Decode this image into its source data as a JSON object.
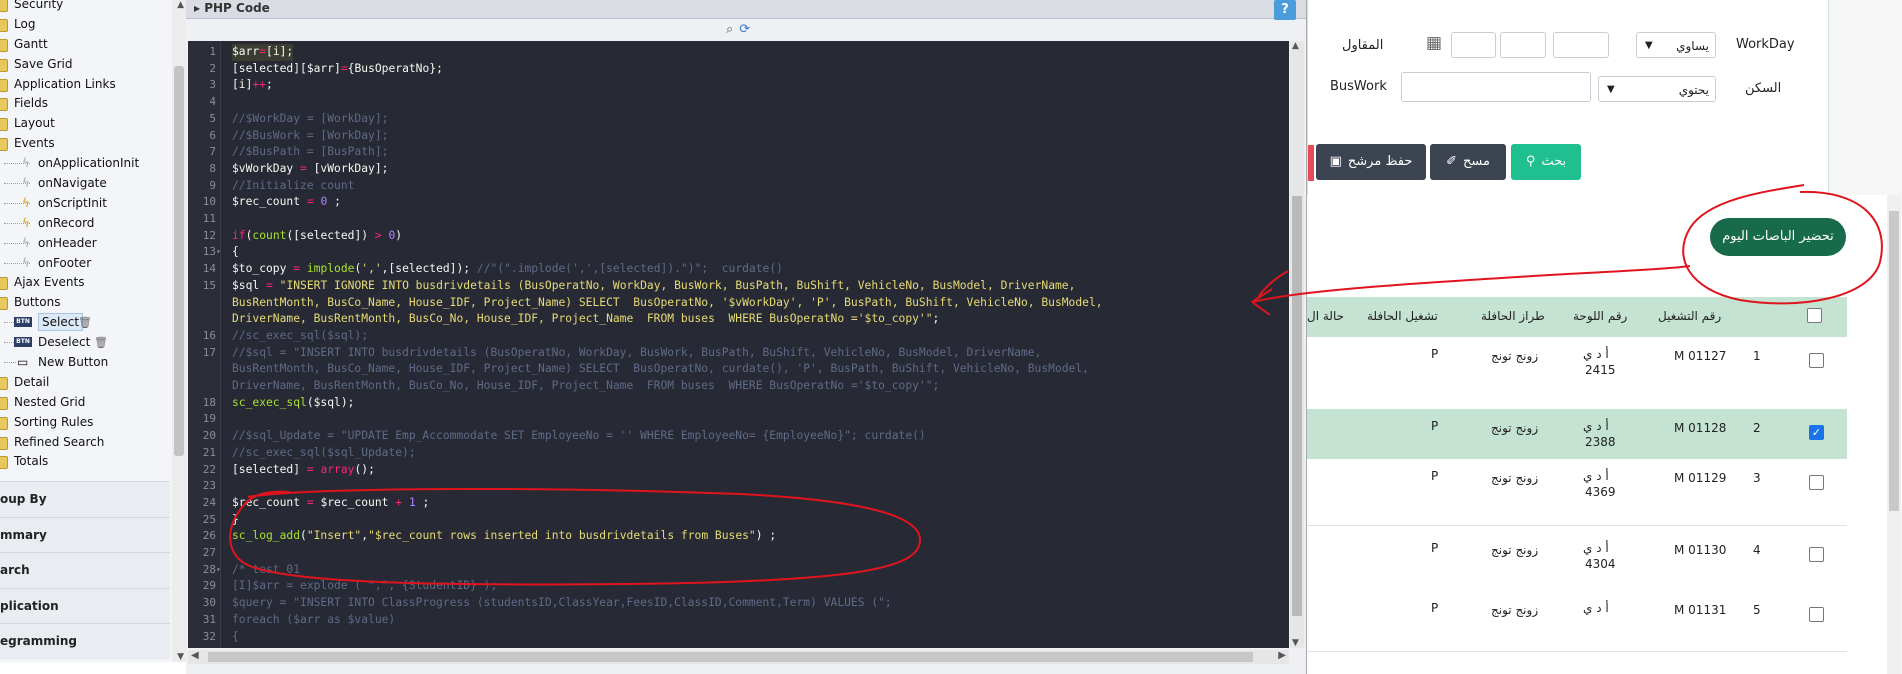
{
  "tree": {
    "items": [
      {
        "label": "Security",
        "kind": "folder",
        "indent": 14
      },
      {
        "label": "Log",
        "kind": "folder",
        "indent": 14
      },
      {
        "label": "Gantt",
        "kind": "folder",
        "indent": 14
      },
      {
        "label": "Save Grid",
        "kind": "folder",
        "indent": 14
      },
      {
        "label": "Application Links",
        "kind": "folder",
        "indent": 14
      },
      {
        "label": "Fields",
        "kind": "folder",
        "indent": 14
      },
      {
        "label": "Layout",
        "kind": "folder",
        "indent": 14
      },
      {
        "label": "Events",
        "kind": "folder",
        "indent": 14
      },
      {
        "label": "onApplicationInit",
        "kind": "event",
        "indent": 38,
        "active": false
      },
      {
        "label": "onNavigate",
        "kind": "event",
        "indent": 38,
        "active": false
      },
      {
        "label": "onScriptInit",
        "kind": "event",
        "indent": 38,
        "active": true
      },
      {
        "label": "onRecord",
        "kind": "event",
        "indent": 38,
        "active": true
      },
      {
        "label": "onHeader",
        "kind": "event",
        "indent": 38,
        "active": false
      },
      {
        "label": "onFooter",
        "kind": "event",
        "indent": 38,
        "active": false
      },
      {
        "label": "Ajax Events",
        "kind": "folder",
        "indent": 14
      },
      {
        "label": "Buttons",
        "kind": "folder",
        "indent": 14
      },
      {
        "label": "Select",
        "kind": "button",
        "indent": 38,
        "selected": true,
        "trash": true
      },
      {
        "label": "Deselect",
        "kind": "button",
        "indent": 38,
        "trash": true
      },
      {
        "label": "New Button",
        "kind": "newbutton",
        "indent": 38
      },
      {
        "label": "Detail",
        "kind": "folder",
        "indent": 14
      },
      {
        "label": "Nested Grid",
        "kind": "folder",
        "indent": 14
      },
      {
        "label": "Sorting Rules",
        "kind": "folder",
        "indent": 14
      },
      {
        "label": "Refined Search",
        "kind": "folder",
        "indent": 14
      },
      {
        "label": "Totals",
        "kind": "folder",
        "indent": 14
      }
    ],
    "sections": [
      "oup By",
      "mmary",
      "arch",
      "plication",
      "egramming"
    ]
  },
  "panel": {
    "title": "PHP Code",
    "help_label": "?",
    "code": [
      {
        "n": "1",
        "html": "<span class='v'>$arr</span><span class='k'>=</span>[i];"
      },
      {
        "n": "2",
        "html": "[selected][<span class='v'>$arr</span>]<span class='k'>=</span>{BusOperatNo};"
      },
      {
        "n": "3",
        "html": "[i]<span class='k'>++</span>;"
      },
      {
        "n": "4",
        "html": ""
      },
      {
        "n": "5",
        "html": "<span class='c'>//$WorkDay = [WorkDay];</span>"
      },
      {
        "n": "6",
        "html": "<span class='c'>//$BusWork = [WorkDay];</span>"
      },
      {
        "n": "7",
        "html": "<span class='c'>//$BusPath = [BusPath];</span>"
      },
      {
        "n": "8",
        "html": "$vWorkDay <span class='k'>=</span> [vWorkDay];"
      },
      {
        "n": "9",
        "html": "<span class='c'>//Initialize count</span>"
      },
      {
        "n": "10",
        "html": "$rec_count <span class='k'>=</span> <span class='n'>0</span> ;"
      },
      {
        "n": "11",
        "html": ""
      },
      {
        "n": "12",
        "html": "<span class='k'>if</span>(<span class='fn'>count</span>([selected]) <span class='k'>&gt;</span> <span class='n'>0</span>)"
      },
      {
        "n": "13",
        "html": "{",
        "fold": true
      },
      {
        "n": "14",
        "html": "$to_copy <span class='k'>=</span> <span class='fn'>implode</span>(<span class='s'>','</span>,[selected]); <span class='c'>//\"(\".implode(',',[selected]).\")\";  curdate()</span>"
      },
      {
        "n": "15",
        "html": "$sql <span class='k'>=</span> <span class='s'>\"INSERT IGNORE INTO busdrivdetails (BusOperatNo, WorkDay, BusWork, BusPath, BuShift, VehicleNo, BusModel, DriverName,</span>"
      },
      {
        "n": "",
        "html": "<span class='s'>BusRentMonth, BusCo_Name, House_IDF, Project_Name) SELECT  BusOperatNo, '$vWorkDay', 'P', BusPath, BuShift, VehicleNo, BusModel,</span>"
      },
      {
        "n": "",
        "html": "<span class='s'>DriverName, BusRentMonth, BusCo_No, House_IDF, Project_Name  FROM buses  WHERE BusOperatNo ='$to_copy'\"</span>;"
      },
      {
        "n": "16",
        "html": "<span class='c'>//sc_exec_sql($sql);</span>"
      },
      {
        "n": "17",
        "html": "<span class='c'>//$sql = \"INSERT INTO busdrivdetails (BusOperatNo, WorkDay, BusWork, BusPath, BuShift, VehicleNo, BusModel, DriverName,</span>"
      },
      {
        "n": "",
        "html": "<span class='c'>BusRentMonth, BusCo_Name, House_IDF, Project_Name) SELECT  BusOperatNo, curdate(), 'P', BusPath, BuShift, VehicleNo, BusModel,</span>"
      },
      {
        "n": "",
        "html": "<span class='c'>DriverName, BusRentMonth, BusCo_No, House_IDF, Project_Name  FROM buses  WHERE BusOperatNo ='$to_copy'\";</span>"
      },
      {
        "n": "18",
        "html": "<span class='fn'>sc_exec_sql</span>($sql);"
      },
      {
        "n": "19",
        "html": ""
      },
      {
        "n": "20",
        "html": "<span class='c'>//$sql_Update = \"UPDATE Emp_Accommodate SET EmployeeNo = '' WHERE EmployeeNo= {EmployeeNo}\"; curdate()</span>"
      },
      {
        "n": "21",
        "html": "<span class='c'>//sc_exec_sql($sql_Update);</span>"
      },
      {
        "n": "22",
        "html": "[selected] <span class='k'>=</span> <span class='k'>array</span>();"
      },
      {
        "n": "23",
        "html": ""
      },
      {
        "n": "24",
        "html": "$rec_count <span class='k'>=</span> $rec_count <span class='k'>+</span> <span class='n'>1</span> ;"
      },
      {
        "n": "25",
        "html": "}"
      },
      {
        "n": "26",
        "html": "<span class='fn'>sc_log_add</span>(<span class='s'>\"Insert\"</span>,<span class='s'>\"$rec_count rows inserted into busdrivdetails from Buses\"</span>) ;"
      },
      {
        "n": "27",
        "html": ""
      },
      {
        "n": "28",
        "html": "<span class='c'>/* test 01</span>",
        "fold": true
      },
      {
        "n": "29",
        "html": "<span class='c'>[I]$arr = explode ( \",\", {StudentID} );</span>"
      },
      {
        "n": "30",
        "html": "<span class='c'>$query = \"INSERT INTO ClassProgress (studentsID,ClassYear,FeesID,ClassID,Comment,Term) VALUES (\";</span>"
      },
      {
        "n": "31",
        "html": "<span class='c'>foreach ($arr as $value)</span>"
      },
      {
        "n": "32",
        "html": "<span class='c'>{</span>"
      }
    ]
  },
  "form": {
    "workday_label": "WorkDay",
    "workday_op": "يساوي",
    "contractor_label": "المقاول",
    "housing_label": "السكن",
    "housing_op": "يحتوي",
    "buswork_label": "BusWork",
    "search_label": "بحث",
    "clear_label": "مسح",
    "save_filter_label": "حفظ مرشح"
  },
  "grid": {
    "action_pill": "تحضير الباصات اليوم",
    "headers": [
      "رقم التشغيل",
      "رقم اللوحة",
      "طراز الحافلة",
      "تشغيل الحافلة",
      "حالة ال"
    ],
    "rows": [
      {
        "num": "1",
        "op": "M 01127",
        "plate1": "أ د ي",
        "plate2": "2415",
        "model": "زونج تونج",
        "status": "P",
        "checked": false
      },
      {
        "num": "2",
        "op": "M 01128",
        "plate1": "أ د ي",
        "plate2": "2388",
        "model": "زونج تونج",
        "status": "P",
        "checked": true
      },
      {
        "num": "3",
        "op": "M 01129",
        "plate1": "أ د ي",
        "plate2": "4369",
        "model": "زونج تونج",
        "status": "P",
        "checked": false
      },
      {
        "num": "4",
        "op": "M 01130",
        "plate1": "أ د ي",
        "plate2": "4304",
        "model": "زونج تونج",
        "status": "P",
        "checked": false
      },
      {
        "num": "5",
        "op": "M 01131",
        "plate1": "أ د ي",
        "plate2": "",
        "model": "زونج تونج",
        "status": "P",
        "checked": false
      }
    ]
  },
  "colors": {
    "accent_green": "#1fbf8f",
    "dark_button": "#3d4451",
    "pill_green": "#176b4a",
    "annotation_red": "#e0141e"
  }
}
